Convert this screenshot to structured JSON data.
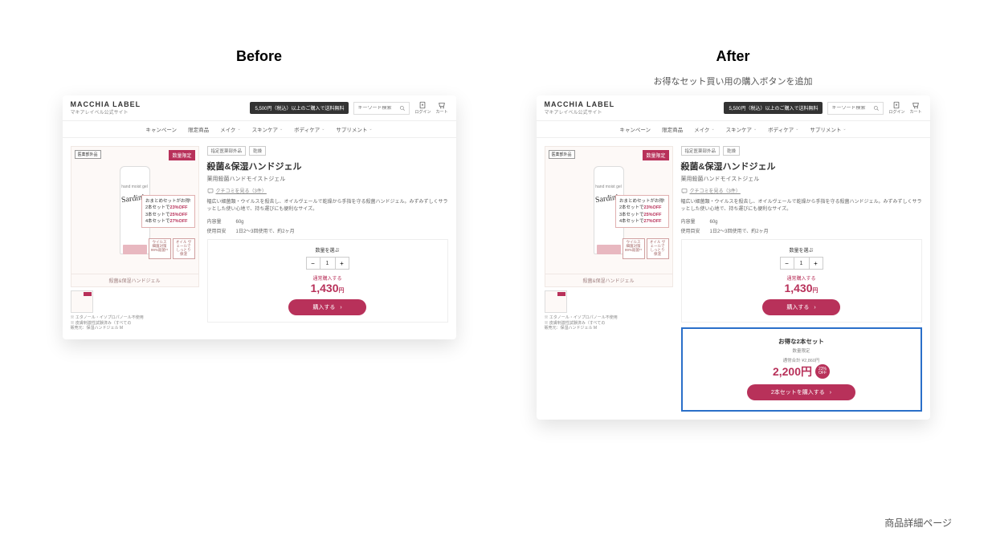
{
  "labels": {
    "before": "Before",
    "after": "After"
  },
  "after_caption": "お得なセット買い用の購入ボタンを追加",
  "page_label": "商品詳細ページ",
  "header": {
    "logo": "MACCHIA LABEL",
    "logo_sub": "マキアレイベル公式サイト",
    "shipping_banner": "5,500円（税込）以上のご購入で送料無料",
    "search_placeholder": "キーワード検索",
    "login": "ログイン",
    "cart": "カート"
  },
  "nav": [
    "キャンペーン",
    "限定商品",
    "メイク",
    "スキンケア",
    "ボディケア",
    "サプリメント"
  ],
  "product": {
    "badge_left": "医薬部外品",
    "badge_right": "数量限定",
    "tube_small": "hand moist gel",
    "tube_script": "Sardinia",
    "img_caption": "殺菌&保湿ハンドジェル",
    "promo_head": "おまとめセットがお得!",
    "promo_lines": [
      {
        "label": "2本セットで",
        "pct": "23%OFF"
      },
      {
        "label": "3本セットで",
        "pct": "25%OFF"
      },
      {
        "label": "4本セットで",
        "pct": "27%OFF"
      }
    ],
    "feat1": "ウイルス\n細菌対策\n99%殺菌*¹",
    "feat2": "オイル\nヴェールで\nしっとり保湿",
    "tags": [
      "指定医薬部外品",
      "乾燥"
    ],
    "name": "殺菌&保湿ハンドジェル",
    "subname": "薬用殺菌ハンドモイストジェル",
    "reviews": "クチコミを見る（3件）",
    "desc": "幅広い細菌類・ウイルスを殺去し、オイルヴェールで乾燥から手指を守る殺菌ハンドジェル。みずみずしくサラッとした使い心地で、持ち運びにも便利なサイズ。",
    "spec1_label": "内容量",
    "spec1_val": "60g",
    "spec2_label": "使用目安",
    "spec2_val": "1日2～3回使用で、約2ヶ月",
    "note1": "※ エタノール・イソプロパノール不使用",
    "note2": "※ 皮膚刺激性試験済み（すべての",
    "note3": "販売元：保湿ハンドジェル  M",
    "qty_label": "数量を選ぶ",
    "qty": "1",
    "price_label": "通常購入する",
    "price": "1,430",
    "yen": "円",
    "buy": "購入する"
  },
  "set": {
    "title": "お得な2本セット",
    "sub": "数量限定",
    "orig": "通常合計 ¥2,860円",
    "price": "2,200円",
    "disc": "23%\nOFF",
    "buy": "2本セットを購入する"
  }
}
